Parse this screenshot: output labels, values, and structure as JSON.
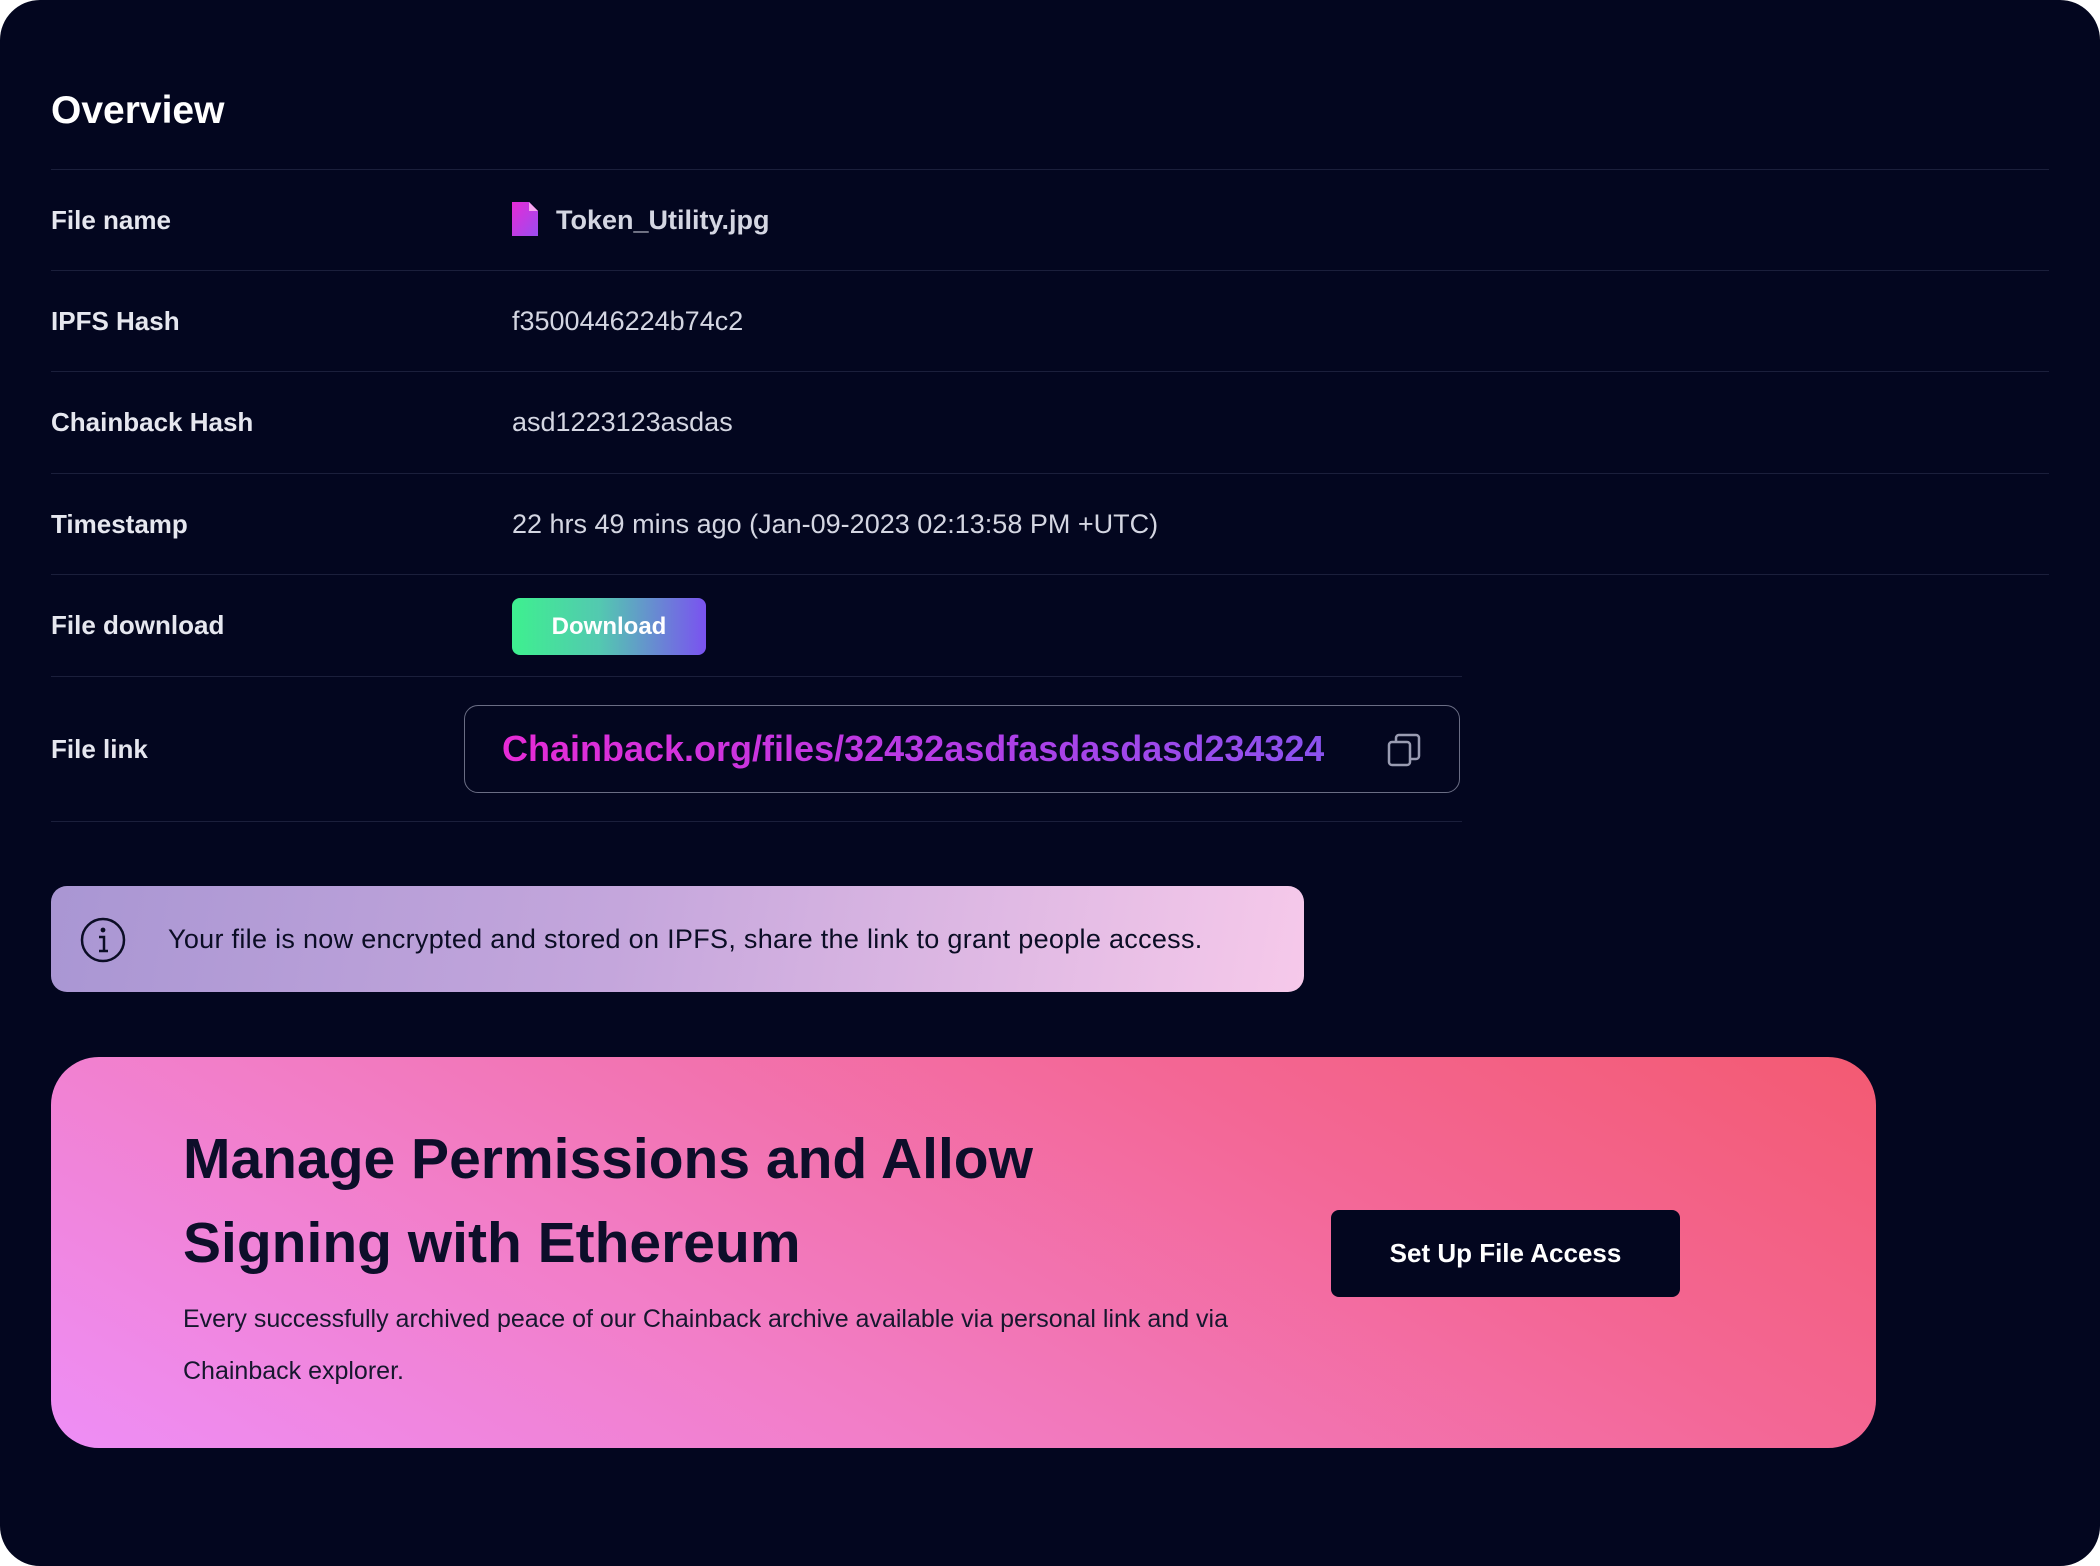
{
  "overview": {
    "title": "Overview",
    "rows": {
      "file_name": {
        "label": "File name",
        "value": "Token_Utility.jpg",
        "icon": "file-icon"
      },
      "ipfs_hash": {
        "label": "IPFS Hash",
        "value": "f3500446224b74c2"
      },
      "chainback_hash": {
        "label": "Chainback Hash",
        "value": "asd1223123asdas"
      },
      "timestamp": {
        "label": "Timestamp",
        "value": "22 hrs 49 mins ago (Jan-09-2023 02:13:58 PM +UTC)"
      },
      "file_download": {
        "label": "File download",
        "button_label": "Download"
      },
      "file_link": {
        "label": "File link",
        "value": "Chainback.org/files/32432asdfasdasdasd234324",
        "copy_icon": "copy-icon"
      }
    }
  },
  "info_banner": {
    "icon": "info-icon",
    "text": "Your file is now encrypted and stored on IPFS, share the link to grant people access."
  },
  "promo": {
    "heading": "Manage Permissions and Allow Signing with Ethereum",
    "text": "Every successfully archived peace of our Chainback archive available via personal link and via Chainback explorer.",
    "button_label": "Set Up File Access"
  },
  "colors": {
    "background": "#03061f",
    "accent_magenta": "#e62bd6",
    "download_gradient_start": "#3ef08f",
    "download_gradient_end": "#7a52f0",
    "promo_gradient_start": "#ee8ef6",
    "promo_gradient_end": "#f35a72"
  }
}
